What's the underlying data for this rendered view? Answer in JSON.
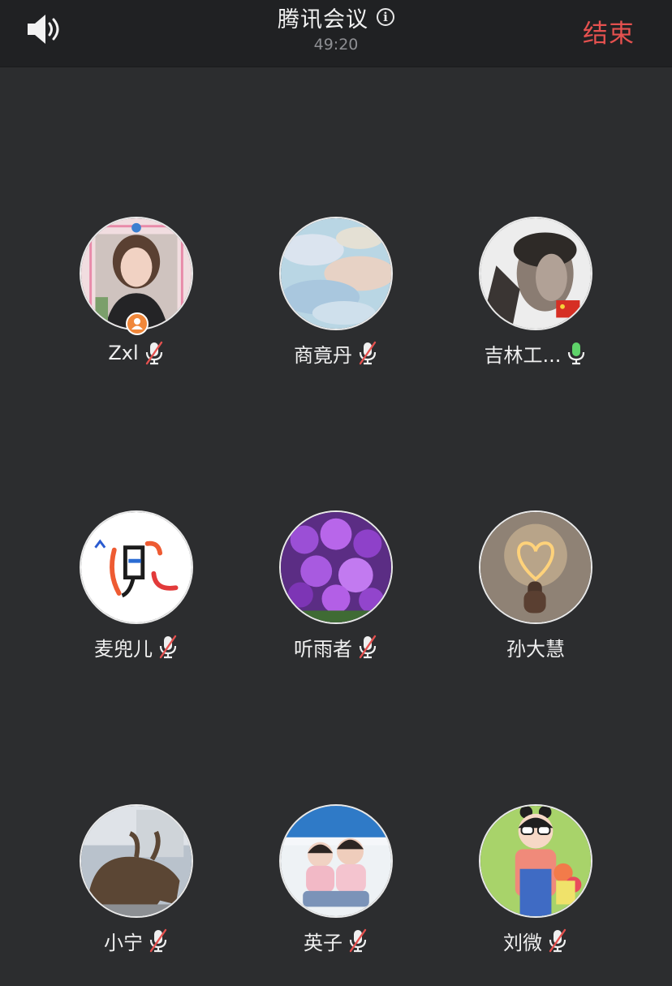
{
  "header": {
    "speaker_icon": "speaker-icon",
    "title": "腾讯会议",
    "info_icon": "info-icon",
    "info_glyph": "i",
    "timer": "49:20",
    "end_label": "结束",
    "end_color": "#e5514f"
  },
  "participants": [
    {
      "name": "Zxl",
      "mic": "muted",
      "host": true
    },
    {
      "name": "商竟丹",
      "mic": "muted"
    },
    {
      "name": "吉林工...",
      "mic": "active"
    },
    {
      "name": "麦兜儿",
      "mic": "muted"
    },
    {
      "name": "听雨者",
      "mic": "muted"
    },
    {
      "name": "孙大慧",
      "mic": "none"
    },
    {
      "name": "小宁",
      "mic": "muted"
    },
    {
      "name": "英子",
      "mic": "muted"
    },
    {
      "name": "刘微",
      "mic": "muted"
    }
  ],
  "colors": {
    "background": "#2c2d2f",
    "topbar": "#202123",
    "mic_active": "#5fd36a",
    "mic_muted_slash": "#e5514f",
    "host_badge": "#f0873a"
  }
}
